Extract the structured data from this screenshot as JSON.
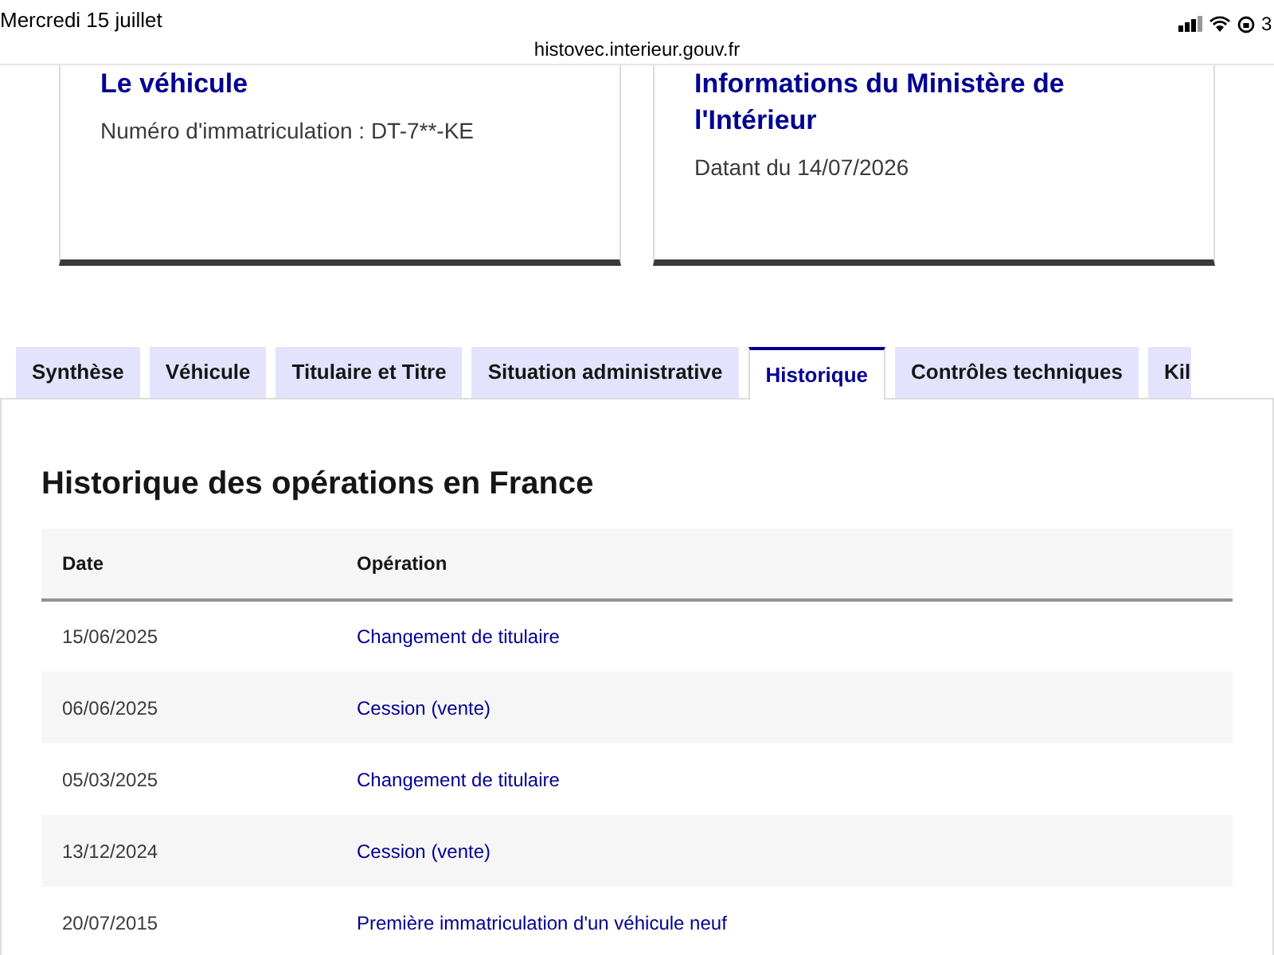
{
  "status_bar": {
    "date": "Mercredi 15 juillet",
    "url": "histovec.interieur.gouv.fr",
    "battery": "3"
  },
  "cards": [
    {
      "title": "Le véhicule",
      "subtitle": "Numéro d'immatriculation : DT-7**-KE"
    },
    {
      "title": "Informations du Ministère de l'Intérieur",
      "subtitle": "Datant du 14/07/2026"
    }
  ],
  "tabs": [
    {
      "label": "Synthèse",
      "selected": false
    },
    {
      "label": "Véhicule",
      "selected": false
    },
    {
      "label": "Titulaire et Titre",
      "selected": false
    },
    {
      "label": "Situation administrative",
      "selected": false
    },
    {
      "label": "Historique",
      "selected": true
    },
    {
      "label": "Contrôles techniques",
      "selected": false
    },
    {
      "label": "Kil",
      "selected": false
    }
  ],
  "panel": {
    "title": "Historique des opérations en France",
    "table": {
      "columns": [
        "Date",
        "Opération"
      ],
      "rows": [
        [
          "15/06/2025",
          "Changement de titulaire"
        ],
        [
          "06/06/2025",
          "Cession (vente)"
        ],
        [
          "05/03/2025",
          "Changement de titulaire"
        ],
        [
          "13/12/2024",
          "Cession (vente)"
        ],
        [
          "20/07/2015",
          "Première immatriculation d'un véhicule neuf"
        ]
      ]
    }
  }
}
